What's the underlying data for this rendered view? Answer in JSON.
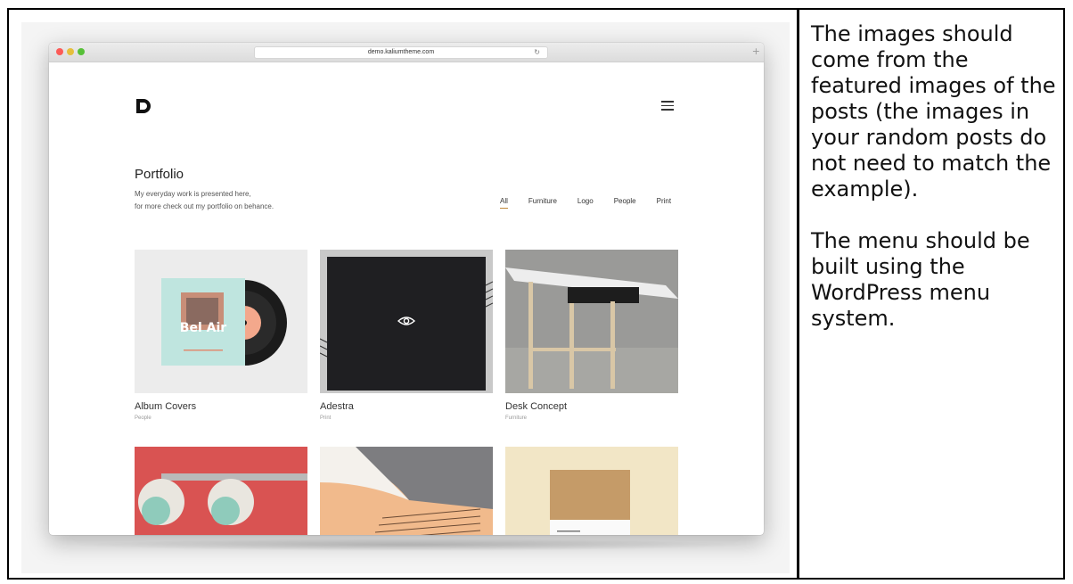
{
  "browser": {
    "url": "demo.kaliumtheme.com",
    "reload_glyph": "↻",
    "new_tab_glyph": "+"
  },
  "site": {
    "logo_icon": "d-logo-icon",
    "menu_icon": "hamburger-menu-icon"
  },
  "portfolio": {
    "title": "Portfolio",
    "desc_line1": "My everyday work is presented here,",
    "desc_line2": "for more check out my portfolio on behance.",
    "filters": [
      "All",
      "Furniture",
      "Logo",
      "People",
      "Print"
    ],
    "active_filter": "All",
    "items": [
      {
        "title": "Album Covers",
        "category": "People",
        "cover_text": "Bel Air"
      },
      {
        "title": "Adestra",
        "category": "Print",
        "hover_icon": "eye-icon"
      },
      {
        "title": "Desk Concept",
        "category": "Furniture"
      },
      {
        "title": "",
        "category": ""
      },
      {
        "title": "",
        "category": ""
      },
      {
        "title": "",
        "category": ""
      }
    ]
  },
  "note": {
    "para1": "The images should come from the featured images of the posts (the images in your random posts do not need to match the example).",
    "para2": "The menu should be built using the WordPress menu system."
  }
}
